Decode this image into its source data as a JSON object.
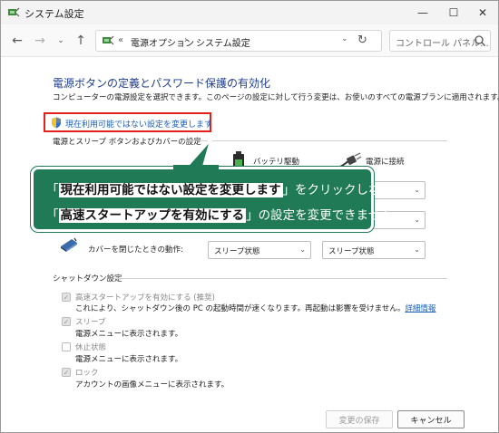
{
  "window": {
    "title": "システム設定",
    "min_glyph": "—",
    "max_glyph": "☐",
    "close_glyph": "✕"
  },
  "nav": {
    "back": "←",
    "forward": "→",
    "recent": "⌄",
    "up": "↑",
    "breadcrumb_sep": "«",
    "crumbs": [
      "電源オプション",
      "システム設定"
    ],
    "crumb_arrow": "›",
    "address_dropdown": "⌄",
    "refresh": "↻",
    "search_placeholder": "コントロール パネル..."
  },
  "main": {
    "title": "電源ボタンの定義とパスワード保護の有効化",
    "description": "コンピューターの電源設定を選択できます。このページの設定に対して行う変更は、お使いのすべての電源プランに適用されます。",
    "change_link": "現在利用可能ではない設定を変更します",
    "section_power": "電源とスリープ ボタンおよびカバーの設定",
    "col_battery": "バッテリ駆動",
    "col_plugged": "電源に接続",
    "lid_label": "カバーを閉じたときの動作:",
    "lid_battery_value": "スリープ状態",
    "lid_plugged_value": "スリープ状態",
    "section_shutdown": "シャットダウン設定",
    "options": [
      {
        "label": "高速スタートアップを有効にする (推奨)",
        "desc": "これにより、シャットダウン後の PC の起動時間が速くなります。再起動は影響を受けません。",
        "link": "詳細情報",
        "checked": true
      },
      {
        "label": "スリープ",
        "desc": "電源メニューに表示されます。",
        "checked": true
      },
      {
        "label": "休止状態",
        "desc": "電源メニューに表示されます。",
        "checked": false
      },
      {
        "label": "ロック",
        "desc": "アカウントの画像メニューに表示されます。",
        "checked": true
      }
    ],
    "dropdown_arrow": "⌄",
    "check_glyph": "✓"
  },
  "buttons": {
    "save": "変更の保存",
    "cancel": "キャンセル"
  },
  "callout": {
    "line1_open": "「",
    "line1_highlight": "現在利用可能ではない設定を変更します",
    "line1_close": "」をクリックしないと",
    "line2_open": "「",
    "line2_highlight": "高速スタートアップを有効にする",
    "line2_close": "」の設定を変更できません"
  },
  "colors": {
    "callout_bg": "#1f7a55",
    "link": "#1b5fb6",
    "title": "#1e3d8f",
    "highlight_border": "#e2211c"
  }
}
